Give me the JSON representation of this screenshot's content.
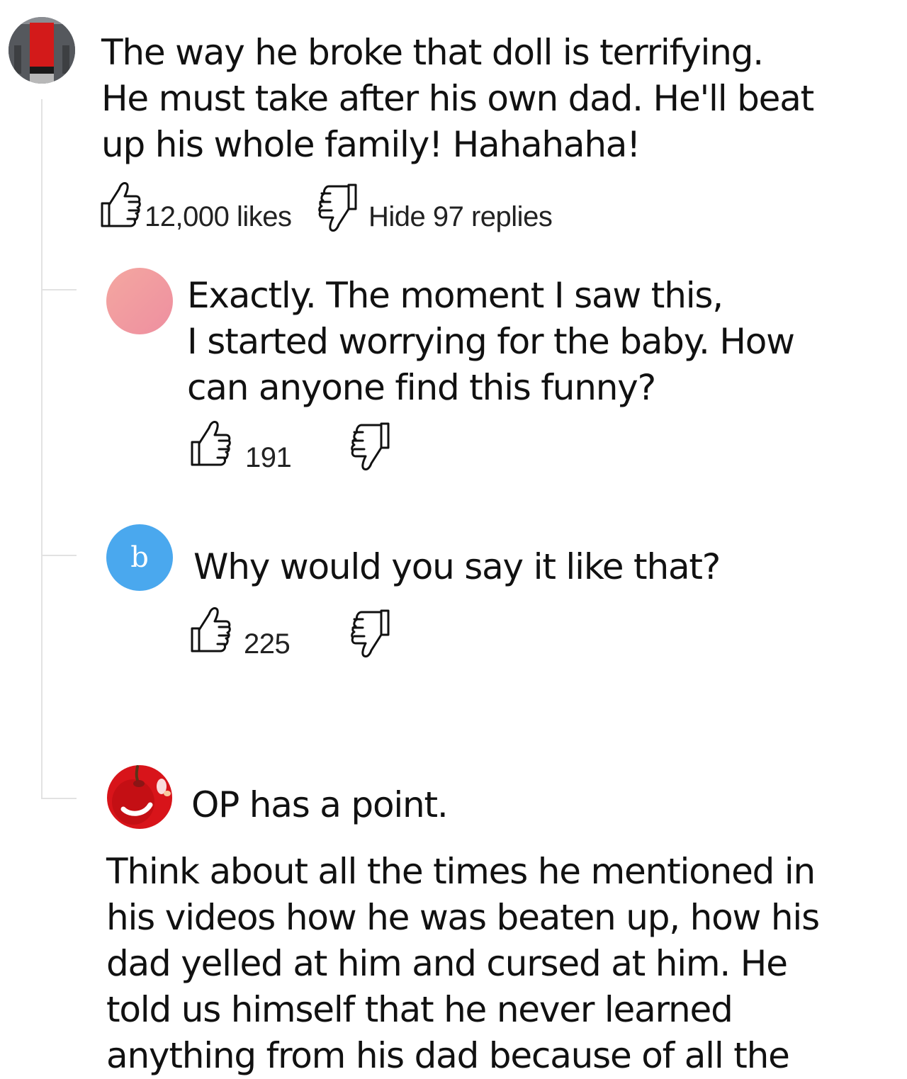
{
  "colors": {
    "thread_line": "#e2e2e2",
    "text": "#111111",
    "blue_avatar": "#4aa8ee",
    "pink_avatar": "#f2a0a0"
  },
  "main_comment": {
    "avatar_icon": "red-shirt-person-avatar",
    "text": "The way he broke that doll is terrifying.\nHe must take after his own dad. He'll beat\nup his whole family! Hahahaha!",
    "likes_label": "12,000 likes",
    "hide_replies_label": "Hide 97 replies"
  },
  "replies": [
    {
      "avatar_icon": "pink-gradient-avatar",
      "text": "Exactly. The moment I saw this,\nI started worrying for the baby. How\ncan anyone find this funny?",
      "likes": "191"
    },
    {
      "avatar_icon": "letter-b-avatar",
      "avatar_letter": "b",
      "text": "Why would you say it like that?",
      "likes": "225"
    },
    {
      "avatar_icon": "cherry-avatar",
      "text": "OP has a point.",
      "text_continued": "Think about all the times he mentioned in\nhis videos how he was beaten up, how his\ndad yelled at him and cursed at him. He\ntold us himself that he never learned\nanything from his dad because of all the"
    }
  ]
}
